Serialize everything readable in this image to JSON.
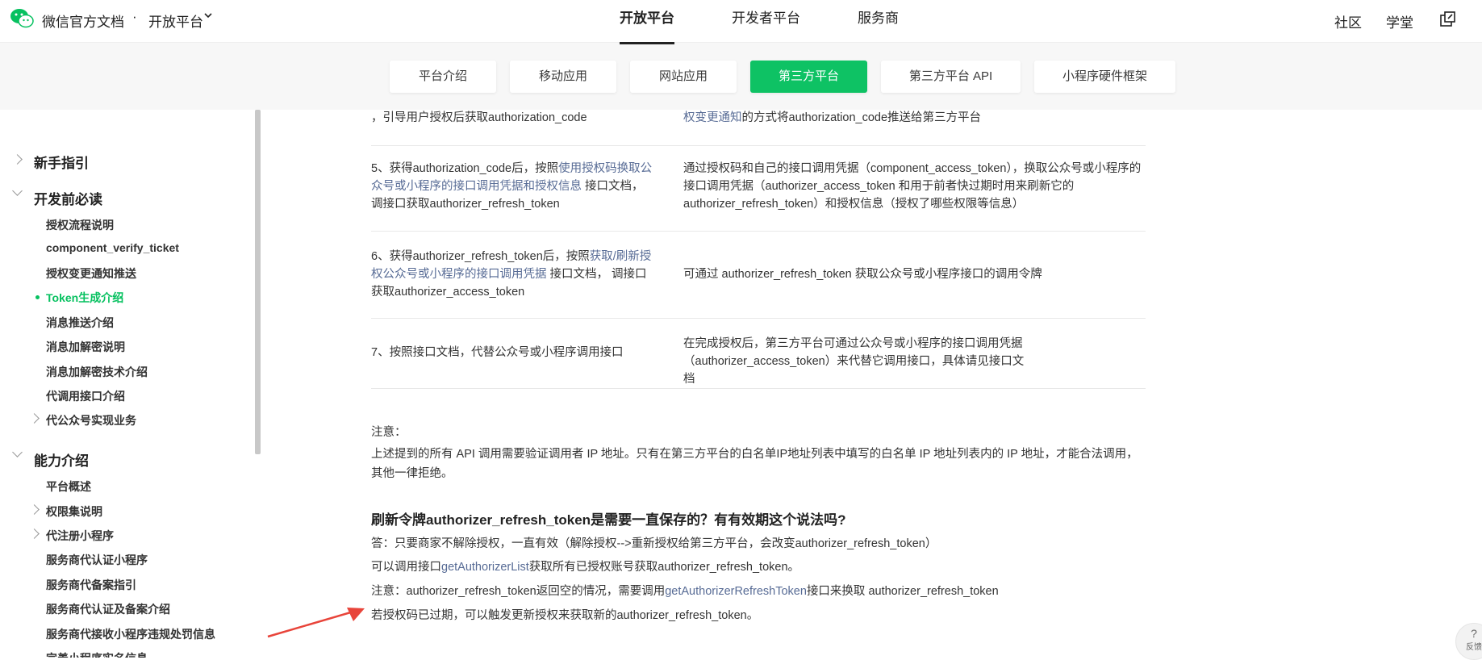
{
  "header": {
    "brand": "微信官方文档",
    "separator": "·",
    "platform": "开放平台",
    "nav": [
      "开放平台",
      "开发者平台",
      "服务商"
    ],
    "right": [
      "社区",
      "学堂"
    ]
  },
  "subnav": [
    "平台介绍",
    "移动应用",
    "网站应用",
    "第三方平台",
    "第三方平台 API",
    "小程序硬件框架"
  ],
  "sidebar": {
    "sections": [
      {
        "label": "新手指引",
        "items": []
      },
      {
        "label": "开发前必读",
        "items": [
          "授权流程说明",
          "component_verify_ticket",
          "授权变更通知推送",
          "Token生成介绍",
          "消息推送介绍",
          "消息加解密说明",
          "消息加解密技术介绍",
          "代调用接口介绍",
          "代公众号实现业务"
        ]
      },
      {
        "label": "能力介绍",
        "items": [
          "平台概述",
          "权限集说明",
          "代注册小程序",
          "服务商代认证小程序",
          "服务商代备案指引",
          "服务商代认证及备案介绍",
          "服务商代接收小程序违规处罚信息",
          "完善小程序实名信息"
        ]
      }
    ]
  },
  "table": {
    "row0": {
      "left": "，引导用户授权后获取authorization_code",
      "right_link": "权变更通知",
      "right_rest": "的方式将authorization_code推送给第三方平台"
    },
    "row1": {
      "left_a": "5、获得authorization_code后，按照",
      "left_link": "使用授权码换取公众号或小程序的接口调用凭据和授权信息",
      "left_b": " 接口文档，调接口获取authorizer_refresh_token",
      "right": "通过授权码和自己的接口调用凭据（component_access_token），换取公众号或小程序的接口调用凭据（authorizer_access_token 和用于前者快过期时用来刷新它的authorizer_refresh_token）和授权信息（授权了哪些权限等信息）"
    },
    "row2": {
      "left_a": "6、获得authorizer_refresh_token后，按照",
      "left_link": "获取/刷新授权公众号或小程序的接口调用凭据",
      "left_b": " 接口文档， 调接口获取authorizer_access_token",
      "right": "可通过 authorizer_refresh_token 获取公众号或小程序接口的调用令牌"
    },
    "row3": {
      "left": "7、按照接口文档，代替公众号或小程序调用接口",
      "right": "在完成授权后，第三方平台可通过公众号或小程序的接口调用凭据（authorizer_access_token）来代替它调用接口，具体请见接口文档"
    }
  },
  "note": {
    "title": "注意：",
    "body": "上述提到的所有 API 调用需要验证调用者 IP 地址。只有在第三方平台的白名单IP地址列表中填写的白名单 IP 地址列表内的 IP 地址，才能合法调用，其他一律拒绝。"
  },
  "faq": {
    "heading": "刷新令牌authorizer_refresh_token是需要一直保存的？有有效期这个说法吗?",
    "answer": "答：只要商家不解除授权，一直有效（解除授权-->重新授权给第三方平台，会改变authorizer_refresh_token）",
    "line2_a": "可以调用接口",
    "line2_link": "getAuthorizerList",
    "line2_b": "获取所有已授权账号获取authorizer_refresh_token。",
    "line3_a": "注意：authorizer_refresh_token返回空的情况，需要调用",
    "line3_link": "getAuthorizerRefreshToken",
    "line3_b": "接口来换取 authorizer_refresh_token",
    "line4": "若授权码已过期，可以触发更新授权来获取新的authorizer_refresh_token。"
  },
  "help": {
    "mark": "?",
    "label": "反馈"
  },
  "colors": {
    "brand_green": "#07c160",
    "link": "#576b95",
    "arrow": "#e8443a"
  },
  "icons": [
    "wechat-logo-icon",
    "chevron-down-icon",
    "external-link-icon",
    "chevron-right-icon",
    "annotation-arrow-icon"
  ]
}
